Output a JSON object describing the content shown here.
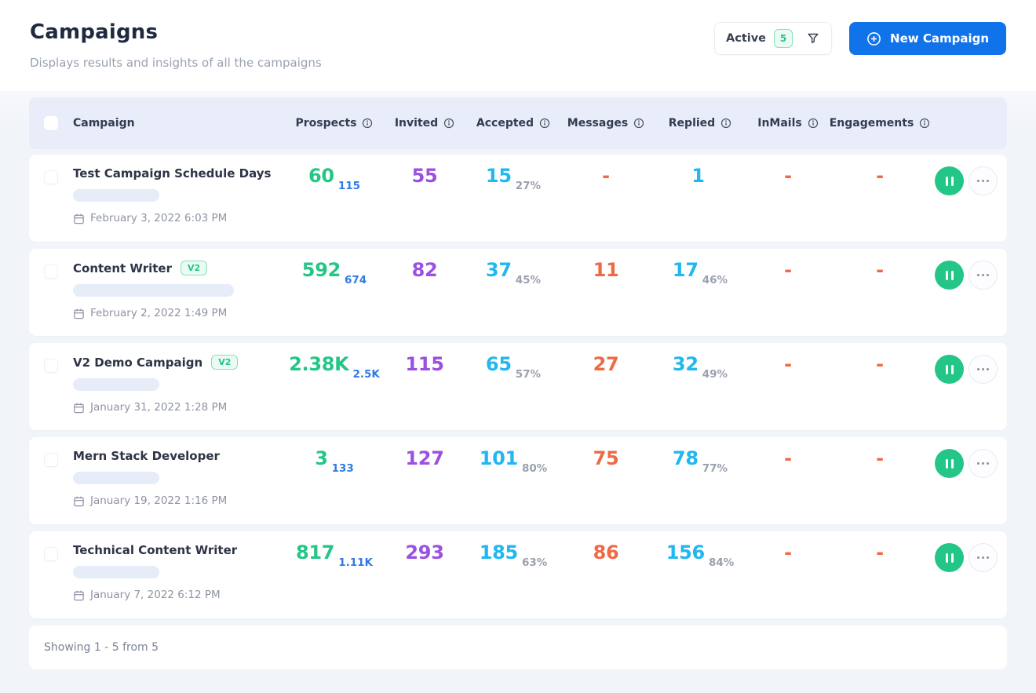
{
  "page": {
    "title": "Campaigns",
    "subtitle": "Displays results and insights of all the campaigns"
  },
  "toolbar": {
    "filter_label": "Active",
    "filter_count": "5",
    "new_campaign_label": "New Campaign"
  },
  "colors": {
    "green": "#24C687",
    "blue": "#2F7BE5",
    "purple": "#9B51E0",
    "cyan": "#21B7F0",
    "orange": "#ED6A45",
    "primary": "#1173E9",
    "header_band": "#E8EDF9",
    "zone_bg": "#F1F4F9",
    "badge_bg": "#EAFBF3",
    "badge_border": "#86E2B9"
  },
  "table": {
    "columns": [
      "Campaign",
      "Prospects",
      "Invited",
      "Accepted",
      "Messages",
      "Replied",
      "InMails",
      "Engagements"
    ],
    "rows": [
      {
        "name": "Test Campaign Schedule Days",
        "date": "February 3, 2022 6:03 PM",
        "skeleton_width": 110,
        "prospects": {
          "value": "60",
          "sub": "115"
        },
        "invited": {
          "value": "55"
        },
        "accepted": {
          "value": "15",
          "sub": "27%"
        },
        "messages": {
          "value": "-"
        },
        "replied": {
          "value": "1"
        },
        "inmails": {
          "value": "-"
        },
        "engagements": {
          "value": "-"
        }
      },
      {
        "name": "Content Writer",
        "badge": "V2",
        "date": "February 2, 2022 1:49 PM",
        "skeleton_width": 205,
        "prospects": {
          "value": "592",
          "sub": "674"
        },
        "invited": {
          "value": "82"
        },
        "accepted": {
          "value": "37",
          "sub": "45%"
        },
        "messages": {
          "value": "11"
        },
        "replied": {
          "value": "17",
          "sub": "46%"
        },
        "inmails": {
          "value": "-"
        },
        "engagements": {
          "value": "-"
        }
      },
      {
        "name": "V2 Demo Campaign",
        "badge": "V2",
        "date": "January 31, 2022 1:28 PM",
        "skeleton_width": 110,
        "prospects": {
          "value": "2.38K",
          "sub": "2.5K"
        },
        "invited": {
          "value": "115"
        },
        "accepted": {
          "value": "65",
          "sub": "57%"
        },
        "messages": {
          "value": "27"
        },
        "replied": {
          "value": "32",
          "sub": "49%"
        },
        "inmails": {
          "value": "-"
        },
        "engagements": {
          "value": "-"
        }
      },
      {
        "name": "Mern Stack Developer",
        "date": "January 19, 2022 1:16 PM",
        "skeleton_width": 110,
        "prospects": {
          "value": "3",
          "sub": "133"
        },
        "invited": {
          "value": "127"
        },
        "accepted": {
          "value": "101",
          "sub": "80%"
        },
        "messages": {
          "value": "75"
        },
        "replied": {
          "value": "78",
          "sub": "77%"
        },
        "inmails": {
          "value": "-"
        },
        "engagements": {
          "value": "-"
        }
      },
      {
        "name": "Technical Content Writer",
        "date": "January 7, 2022 6:12 PM",
        "skeleton_width": 110,
        "prospects": {
          "value": "817",
          "sub": "1.11K"
        },
        "invited": {
          "value": "293"
        },
        "accepted": {
          "value": "185",
          "sub": "63%"
        },
        "messages": {
          "value": "86"
        },
        "replied": {
          "value": "156",
          "sub": "84%"
        },
        "inmails": {
          "value": "-"
        },
        "engagements": {
          "value": "-"
        }
      }
    ]
  },
  "footer": {
    "summary": "Showing 1 - 5 from 5"
  }
}
